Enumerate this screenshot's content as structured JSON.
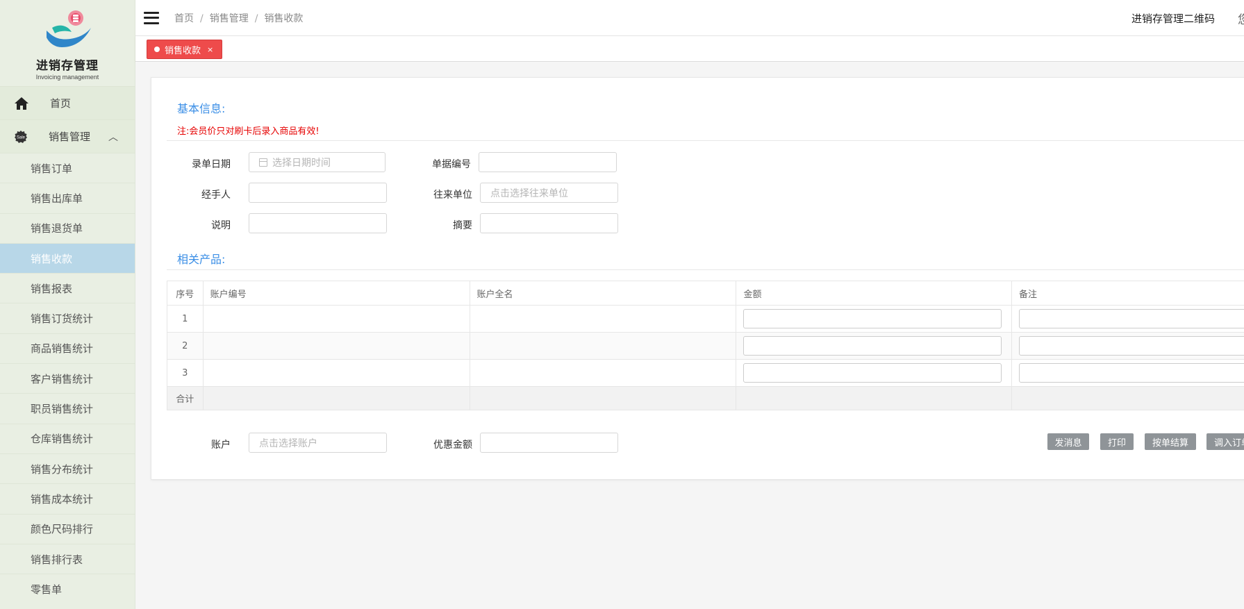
{
  "app": {
    "logo_title": "进销存管理",
    "logo_subtitle": "Invoicing management"
  },
  "sidebar": {
    "home_label": "首页",
    "group_label": "销售管理",
    "items": [
      {
        "label": "销售订单"
      },
      {
        "label": "销售出库单"
      },
      {
        "label": "销售退货单"
      },
      {
        "label": "销售收款",
        "active": true
      },
      {
        "label": "销售报表"
      },
      {
        "label": "销售订货统计"
      },
      {
        "label": "商品销售统计"
      },
      {
        "label": "客户销售统计"
      },
      {
        "label": "职员销售统计"
      },
      {
        "label": "仓库销售统计"
      },
      {
        "label": "销售分布统计"
      },
      {
        "label": "销售成本统计"
      },
      {
        "label": "颜色尺码排行"
      },
      {
        "label": "销售排行表"
      },
      {
        "label": "零售单"
      }
    ]
  },
  "header": {
    "breadcrumb": [
      "首页",
      "销售管理",
      "销售收款"
    ],
    "right_link": "进销存管理二维码",
    "cut_text": "您"
  },
  "tabs": {
    "active_tab": "销售收款",
    "close_glyph": "×"
  },
  "form": {
    "section_basic": "基本信息:",
    "note": "注:会员价只对刷卡后录入商品有效!",
    "fields": {
      "date_label": "录单日期",
      "date_placeholder": "选择日期时间",
      "doc_no_label": "单据编号",
      "handler_label": "经手人",
      "partner_label": "往来单位",
      "partner_placeholder": "点击选择往来单位",
      "desc_label": "说明",
      "summary_label": "摘要"
    },
    "section_products": "相关产品:"
  },
  "table": {
    "headers": [
      "序号",
      "账户编号",
      "账户全名",
      "金额",
      "备注"
    ],
    "rows": [
      "1",
      "2",
      "3"
    ],
    "total_label": "合计"
  },
  "footer": {
    "account_label": "账户",
    "account_placeholder": "点击选择账户",
    "discount_label": "优惠金额",
    "buttons": [
      "发消息",
      "打印",
      "按单结算",
      "调入订单"
    ]
  },
  "colors": {
    "accent_blue": "#3a8ee6",
    "tab_red": "#ee4b4b",
    "note_red": "#e60000",
    "sidebar_bg": "#e9efe3",
    "sidebar_active": "#b8d7e8",
    "button_gray": "#8f9498"
  }
}
